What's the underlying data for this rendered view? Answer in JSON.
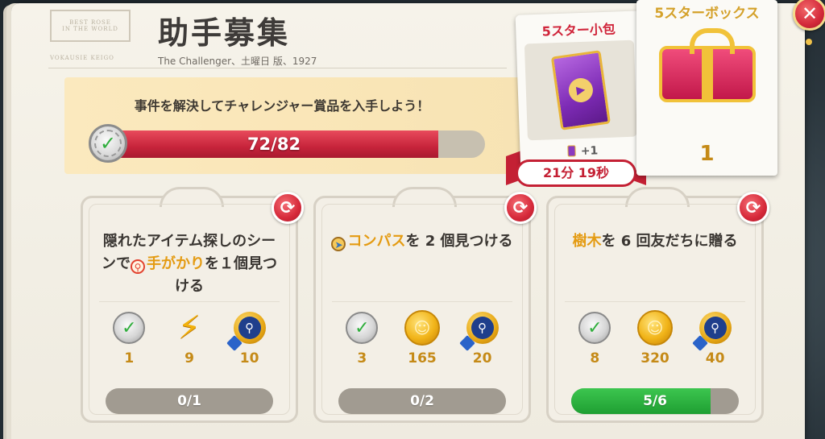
{
  "header": {
    "title": "助手募集",
    "subtitle": "The Challenger、土曜日 版、1927"
  },
  "banner": {
    "text": "事件を解決してチャレンジャー賞品を入手しよう！",
    "progress_label": "72/82",
    "progress_current": 72,
    "progress_total": 82
  },
  "pack": {
    "title": "5スター小包",
    "bonus": "+1",
    "timer": "21分 19秒"
  },
  "box": {
    "title": "5スターボックス",
    "count": "1"
  },
  "quests": [
    {
      "text_before": "隠れたアイテム探しのシーンで",
      "highlight": "手がかり",
      "text_after": "を１個見つける",
      "rewards": [
        "1",
        "9",
        "10"
      ],
      "progress_label": "0/1",
      "progress": 0
    },
    {
      "highlight": "コンパス",
      "text_after": "を 2 個見つける",
      "rewards": [
        "3",
        "165",
        "20"
      ],
      "progress_label": "0/2",
      "progress": 0
    },
    {
      "highlight": "樹木",
      "text_after": "を 6 回友だちに贈る",
      "rewards": [
        "8",
        "320",
        "40"
      ],
      "progress_label": "5/6",
      "progress": 0.833
    }
  ],
  "colors": {
    "accent_red": "#c42034",
    "progress_red": "#d32a40",
    "progress_green": "#27ab3a",
    "gold_text": "#c58a17",
    "highlight_orange": "#e49b12"
  },
  "icons": {
    "close": "close-icon",
    "refresh": "refresh-icon",
    "check_badge": "check-badge-icon",
    "energy": "lightning-icon",
    "coin": "coin-icon",
    "medal": "magnifier-medal-icon"
  }
}
